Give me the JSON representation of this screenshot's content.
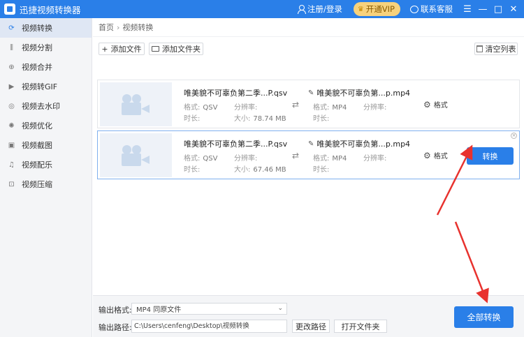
{
  "app": {
    "title": "迅捷视频转换器"
  },
  "titlebar": {
    "login_label": "注册/登录",
    "vip_label": "开通VIP",
    "service_label": "联系客服",
    "menu_glyph": "☰",
    "minimize_glyph": "—",
    "maximize_glyph": "□",
    "close_glyph": "✕"
  },
  "sidebar": {
    "items": [
      {
        "label": "视频转换",
        "icon": "refresh-icon",
        "glyph": "⟳",
        "active": true
      },
      {
        "label": "视频分割",
        "icon": "split-icon",
        "glyph": "⫼",
        "active": false
      },
      {
        "label": "视频合并",
        "icon": "merge-icon",
        "glyph": "⊕",
        "active": false
      },
      {
        "label": "视频转GIF",
        "icon": "gif-icon",
        "glyph": "▶",
        "active": false
      },
      {
        "label": "视频去水印",
        "icon": "watermark-icon",
        "glyph": "◎",
        "active": false
      },
      {
        "label": "视频优化",
        "icon": "optimize-icon",
        "glyph": "✺",
        "active": false
      },
      {
        "label": "视频截图",
        "icon": "screenshot-icon",
        "glyph": "▣",
        "active": false
      },
      {
        "label": "视频配乐",
        "icon": "music-icon",
        "glyph": "♫",
        "active": false
      },
      {
        "label": "视频压缩",
        "icon": "compress-icon",
        "glyph": "⊡",
        "active": false
      }
    ]
  },
  "breadcrumb": {
    "home": "首页",
    "sep": "›",
    "current": "视频转换"
  },
  "toolbar": {
    "add_file": "添加文件",
    "add_folder": "添加文件夹",
    "clear_list": "清空列表"
  },
  "files": [
    {
      "src_name": "唯美貌不可辜负第二季...P.qsv",
      "src_format_label": "格式:",
      "src_format": "QSV",
      "src_res_label": "分辨率:",
      "src_res": "",
      "src_dur_label": "时长:",
      "src_dur": "",
      "src_size_label": "大小:",
      "src_size": "78.74 MB",
      "out_name": "唯美貌不可辜负第...p.mp4",
      "out_format_label": "格式:",
      "out_format": "MP4",
      "out_res_label": "分辨率:",
      "out_res": "",
      "out_dur_label": "时长:",
      "out_dur": "",
      "format_label": "格式"
    },
    {
      "src_name": "唯美貌不可辜负第二季...P.qsv",
      "src_format_label": "格式:",
      "src_format": "QSV",
      "src_res_label": "分辨率:",
      "src_res": "",
      "src_dur_label": "时长:",
      "src_dur": "",
      "src_size_label": "大小:",
      "src_size": "67.46 MB",
      "out_name": "唯美貌不可辜负第...p.mp4",
      "out_format_label": "格式:",
      "out_format": "MP4",
      "out_res_label": "分辨率:",
      "out_res": "",
      "out_dur_label": "时长:",
      "out_dur": "",
      "format_label": "格式",
      "convert_label": "转换"
    }
  ],
  "bottom": {
    "output_format_label": "输出格式:",
    "output_format_value": "MP4  同原文件",
    "output_path_label": "输出路径:",
    "output_path_value": "C:\\Users\\cenfeng\\Desktop\\视频转换",
    "change_path": "更改路径",
    "open_folder": "打开文件夹",
    "convert_all": "全部转换"
  },
  "annotation": {
    "arrow_color": "#e8322e"
  },
  "colors": {
    "primary": "#2a7fe8",
    "vip": "#f7d27d"
  }
}
